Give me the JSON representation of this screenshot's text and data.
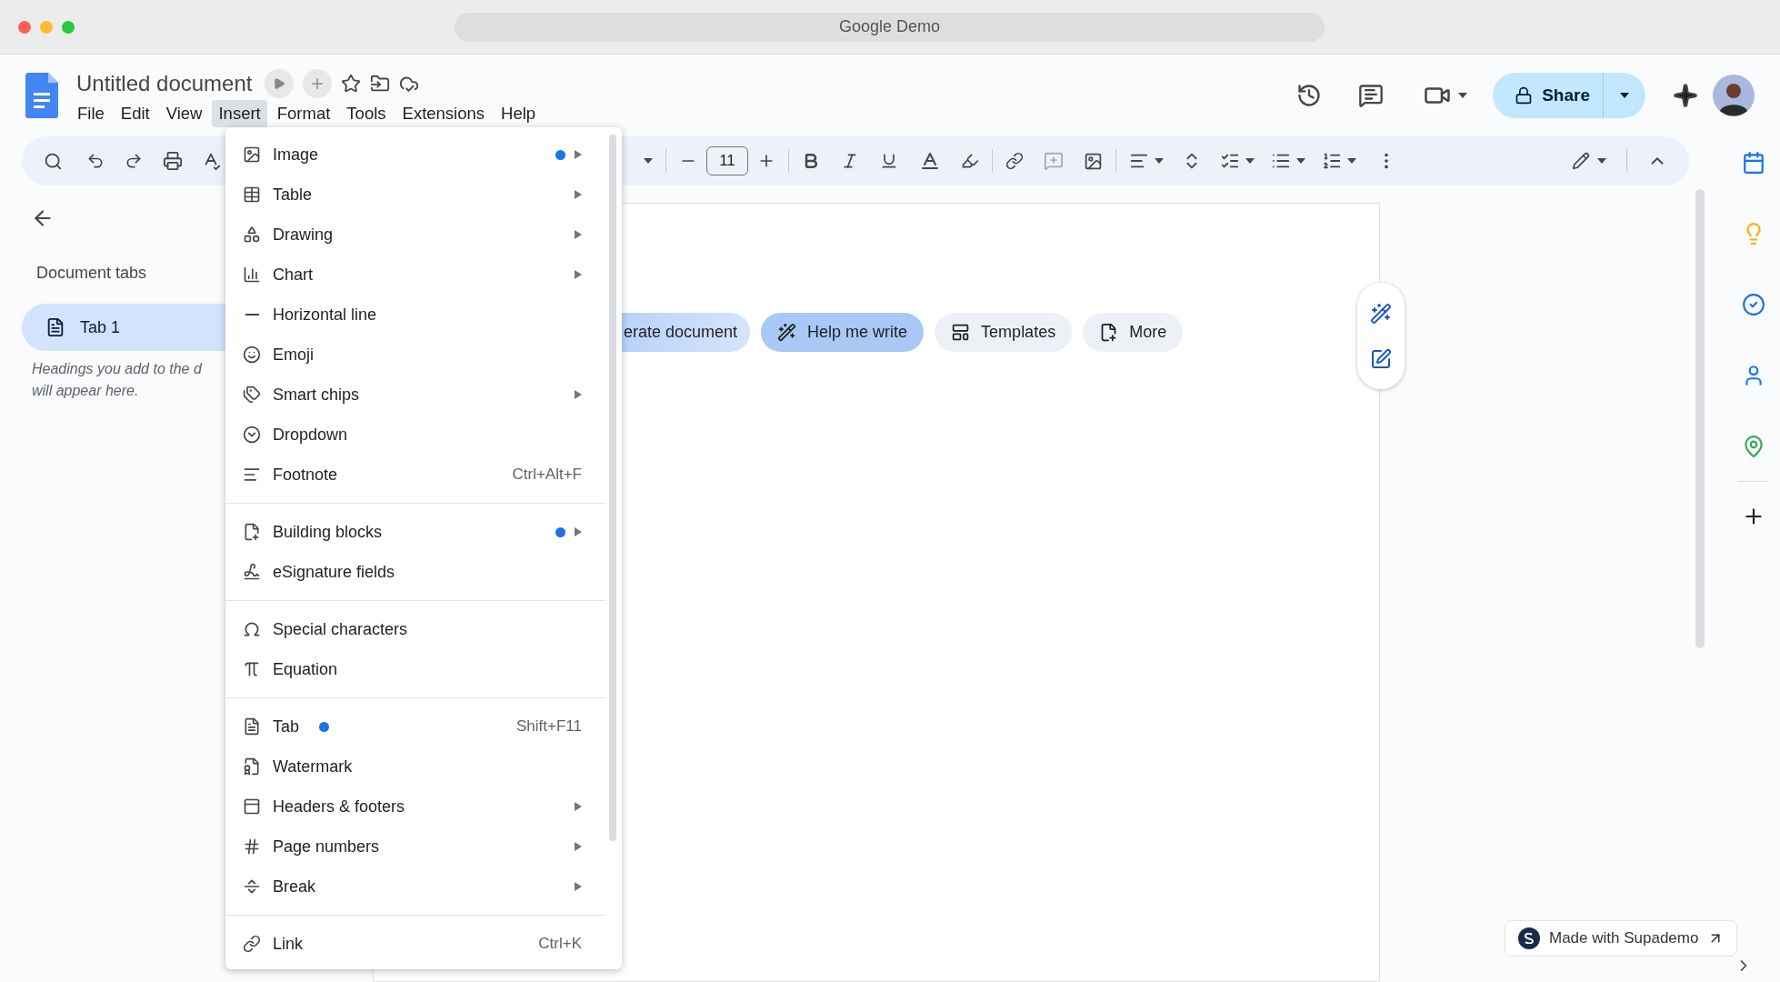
{
  "browser": {
    "address": "Google Demo"
  },
  "document": {
    "title": "Untitled document"
  },
  "menu_bar": [
    {
      "label": "File",
      "selected": false
    },
    {
      "label": "Edit",
      "selected": false
    },
    {
      "label": "View",
      "selected": false
    },
    {
      "label": "Insert",
      "selected": true
    },
    {
      "label": "Format",
      "selected": false
    },
    {
      "label": "Tools",
      "selected": false
    },
    {
      "label": "Extensions",
      "selected": false
    },
    {
      "label": "Help",
      "selected": false
    }
  ],
  "toolbar": {
    "font_size": "11"
  },
  "share": {
    "label": "Share"
  },
  "sidebar": {
    "heading": "Document tabs",
    "tabs": [
      {
        "label": "Tab 1",
        "selected": true
      }
    ],
    "hint_lines": [
      "Headings you add to the d",
      "will appear here."
    ]
  },
  "chips": [
    {
      "label": "erate document",
      "kind": "gradient"
    },
    {
      "label": "Help me write",
      "kind": "highlight"
    },
    {
      "label": "Templates",
      "kind": "plain"
    },
    {
      "label": "More",
      "kind": "plain"
    }
  ],
  "insert_menu": [
    [
      {
        "label": "Image",
        "submenu": true,
        "new": true
      },
      {
        "label": "Table",
        "submenu": true,
        "new": false
      },
      {
        "label": "Drawing",
        "submenu": true,
        "new": false
      },
      {
        "label": "Chart",
        "submenu": true,
        "new": false
      },
      {
        "label": "Horizontal line",
        "submenu": false,
        "new": false
      },
      {
        "label": "Emoji",
        "submenu": false,
        "new": false
      },
      {
        "label": "Smart chips",
        "submenu": true,
        "new": false
      },
      {
        "label": "Dropdown",
        "submenu": false,
        "new": false
      },
      {
        "label": "Footnote",
        "shortcut": "Ctrl+Alt+F",
        "submenu": false,
        "new": false
      }
    ],
    [
      {
        "label": "Building blocks",
        "submenu": true,
        "new": true
      },
      {
        "label": "eSignature fields",
        "submenu": false,
        "new": false
      }
    ],
    [
      {
        "label": "Special characters",
        "submenu": false,
        "new": false
      },
      {
        "label": "Equation",
        "submenu": false,
        "new": false
      }
    ],
    [
      {
        "label": "Tab",
        "shortcut": "Shift+F11",
        "submenu": false,
        "new": true
      },
      {
        "label": "Watermark",
        "submenu": false,
        "new": false
      },
      {
        "label": "Headers & footers",
        "submenu": true,
        "new": false
      },
      {
        "label": "Page numbers",
        "submenu": true,
        "new": false
      },
      {
        "label": "Break",
        "submenu": true,
        "new": false
      }
    ],
    [
      {
        "label": "Link",
        "shortcut": "Ctrl+K",
        "submenu": false,
        "new": false
      }
    ]
  ],
  "badge": {
    "label": "Made with Supademo"
  }
}
